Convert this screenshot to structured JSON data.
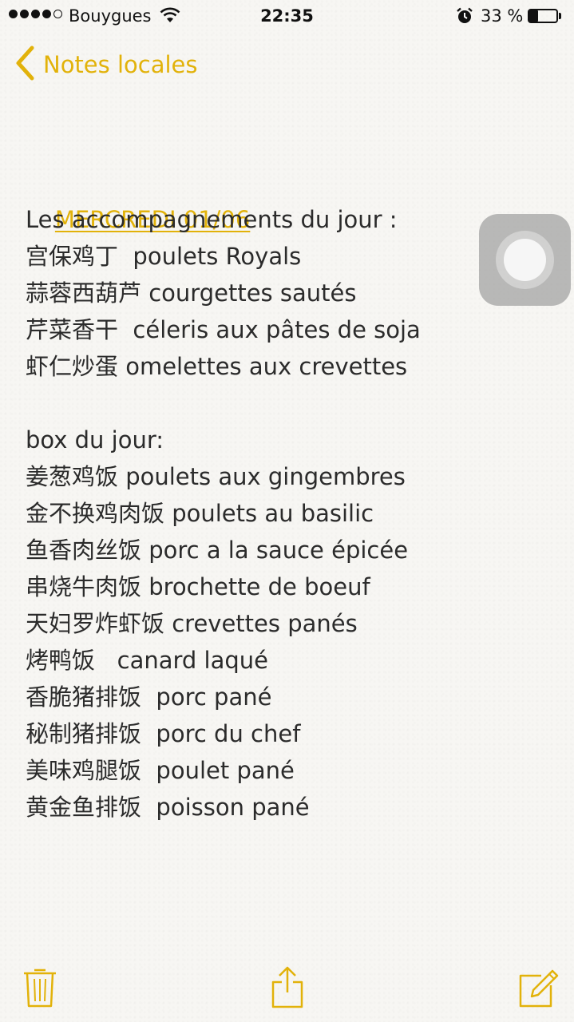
{
  "status_bar": {
    "carrier": "Bouygues",
    "time": "22:35",
    "battery_percent": "33 %",
    "battery_level": 0.33,
    "signal_bars_filled": 4,
    "signal_bars_total": 5
  },
  "nav": {
    "back_label": "Notes locales"
  },
  "note": {
    "date": "MERCREDI 01/06",
    "section1_header": "Les accompagnements du jour :",
    "sides": [
      "宫保鸡丁  poulets Royals",
      "蒜蓉西葫芦 courgettes sautés",
      "芹菜香干  céleris aux pâtes de soja",
      "虾仁炒蛋 omelettes aux crevettes"
    ],
    "section2_header": "box du jour:",
    "boxes": [
      "姜葱鸡饭 poulets aux gingembres",
      "金不换鸡肉饭 poulets au basilic",
      "鱼香肉丝饭 porc a la sauce épicée",
      "串烧牛肉饭 brochette de boeuf",
      "天妇罗炸虾饭 crevettes panés",
      "烤鸭饭   canard laqué",
      "香脆猪排饭  porc pané",
      "秘制猪排饭  porc du chef",
      "美味鸡腿饭  poulet pané",
      "黄金鱼排饭  poisson pané"
    ]
  },
  "colors": {
    "accent": "#e2b20a",
    "text": "#2b2b2b",
    "background": "#f7f6f3"
  },
  "icons": {
    "back": "chevron-left-icon",
    "wifi": "wifi-icon",
    "alarm": "alarm-icon",
    "battery": "battery-icon",
    "trash": "trash-icon",
    "share": "share-icon",
    "compose": "compose-icon"
  }
}
